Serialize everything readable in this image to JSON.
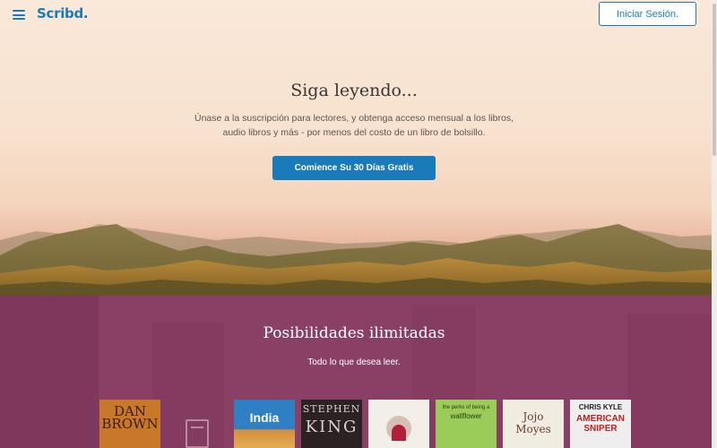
{
  "header": {
    "logo": "Scribd.",
    "login_label": "Iniciar Sesión."
  },
  "hero": {
    "title": "Siga leyendo...",
    "subtitle_line1": "Únase a la suscripción para lectores, y obtenga acceso mensual a los libros,",
    "subtitle_line2": "audio libros y más - por menos del costo de un libro de bolsillo.",
    "cta_label": "Comience Su 30 Días Gratis"
  },
  "section": {
    "title": "Posibilidades ilimitadas",
    "subtitle": "Todo lo que desea leer."
  },
  "books": [
    {
      "line1": "DAN",
      "line2": "BROWN",
      "color": "#c9782a",
      "text_color": "#3a1d08"
    },
    {
      "line1": "India",
      "line2": "",
      "color": "#2f7fc4",
      "text_color": "#ffffff"
    },
    {
      "line1": "STEPHEN",
      "line2": "KING",
      "color": "#2b2224",
      "text_color": "#d9d2cf"
    },
    {
      "line1": "",
      "line2": "",
      "color": "#f2efe9",
      "text_color": "#333333"
    },
    {
      "line1": "the perks of being a",
      "line2": "wallflower",
      "color": "#9bcc5a",
      "text_color": "#2c3b12"
    },
    {
      "line1": "Jojo",
      "line2": "Moyes",
      "color": "#f1ece1",
      "text_color": "#6b3b2b"
    },
    {
      "line1": "CHRIS KYLE",
      "line2": "AMERICAN SNIPER",
      "color": "#eeeeee",
      "text_color": "#c0201d"
    }
  ],
  "colors": {
    "accent": "#1a7bba",
    "section_bg": "#8a3f64"
  }
}
